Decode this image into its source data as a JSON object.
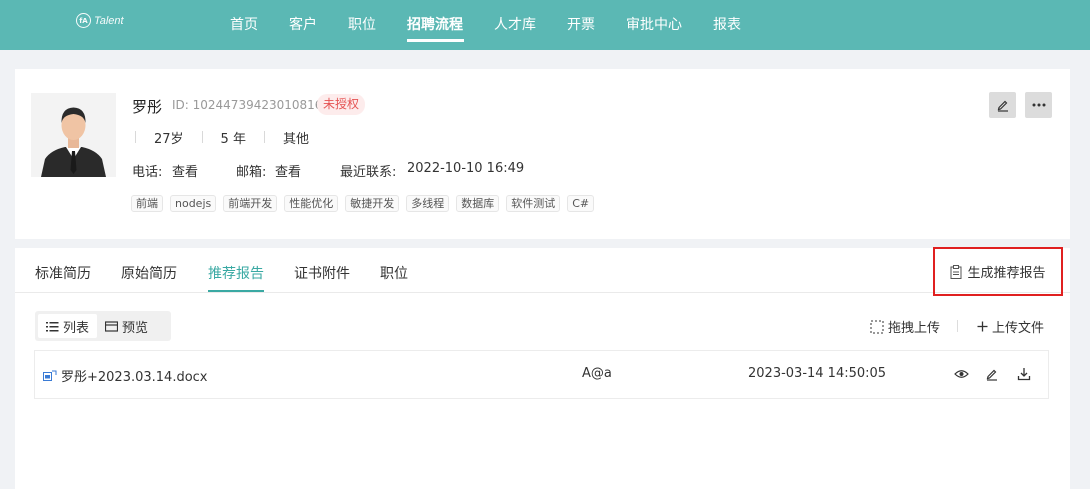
{
  "nav": {
    "logo_text": "Talent",
    "items": [
      "首页",
      "客户",
      "职位",
      "招聘流程",
      "人才库",
      "开票",
      "审批中心",
      "报表"
    ],
    "active_index": 3
  },
  "profile": {
    "name": "罗彤",
    "id_text": "ID: 102447394230108160",
    "status_badge": "未授权",
    "age": "27岁",
    "experience": "5 年",
    "education": "其他",
    "phone_label": "电话:",
    "phone_value": "查看",
    "email_label": "邮箱:",
    "email_value": "查看",
    "last_contact_label": "最近联系:",
    "last_contact_value": "2022-10-10 16:49",
    "tags": [
      "前端",
      "nodejs",
      "前端开发",
      "性能优化",
      "敏捷开发",
      "多线程",
      "数据库",
      "软件测试",
      "C#"
    ]
  },
  "tabs": {
    "items": [
      "标准简历",
      "原始简历",
      "推荐报告",
      "证书附件",
      "职位"
    ],
    "active_index": 2,
    "generate_report_label": "生成推荐报告"
  },
  "toolbar": {
    "list_label": "列表",
    "preview_label": "预览",
    "drag_upload_label": "拖拽上传",
    "upload_file_label": "上传文件"
  },
  "files": [
    {
      "name": "罗彤+2023.03.14.docx",
      "owner": "A@a",
      "time": "2023-03-14 14:50:05"
    }
  ],
  "colors": {
    "nav_bg": "#5bb8b4",
    "accent": "#3aa9a3",
    "badge_red": "#e55353",
    "highlight_border": "#e02020"
  }
}
